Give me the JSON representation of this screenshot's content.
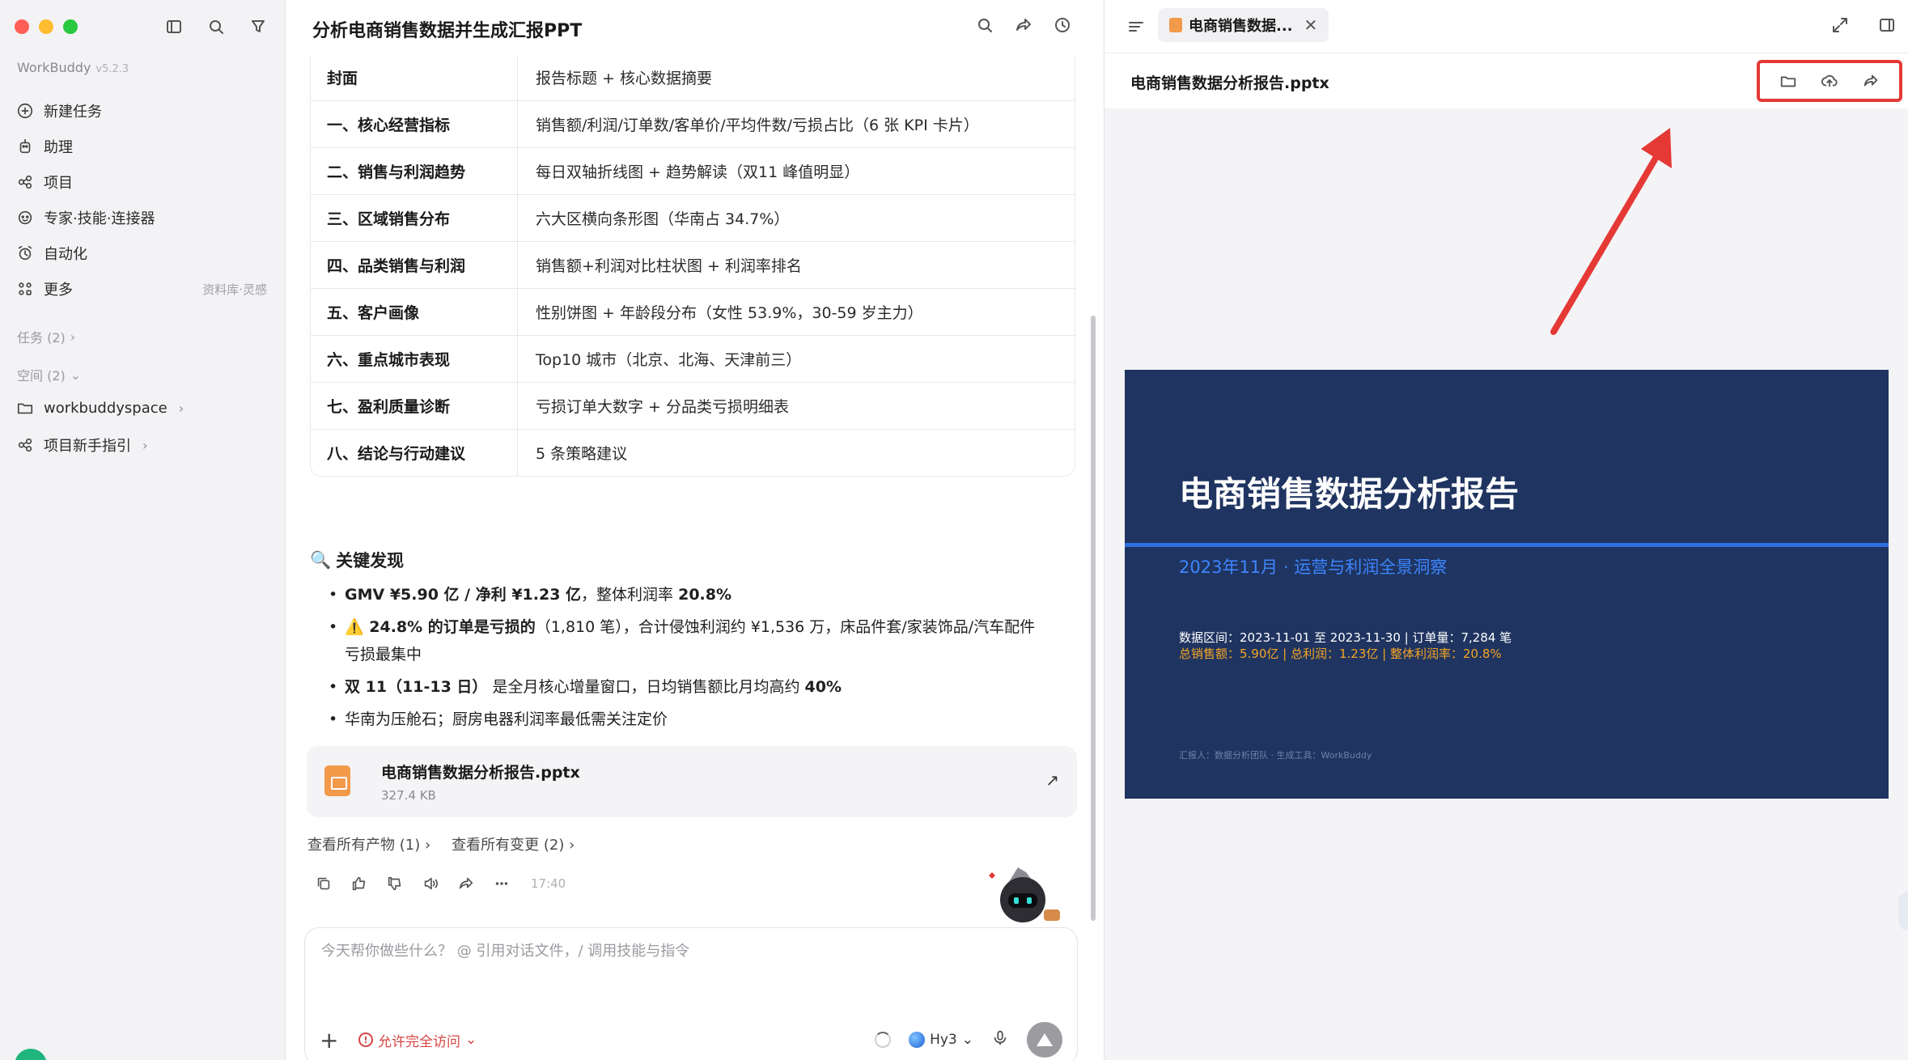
{
  "sidebar": {
    "brand": "WorkBuddy",
    "version": "v5.2.3",
    "nav": [
      {
        "label": "新建任务",
        "icon": "plus-circle-icon"
      },
      {
        "label": "助理",
        "icon": "assistant-icon"
      },
      {
        "label": "项目",
        "icon": "project-icon"
      },
      {
        "label": "专家·技能·连接器",
        "icon": "expert-icon"
      },
      {
        "label": "自动化",
        "icon": "alarm-icon"
      },
      {
        "label": "更多",
        "icon": "grid-icon",
        "right": "资料库·灵感"
      }
    ],
    "tasks_header": "任务 (2)",
    "spaces_header": "空间 (2)",
    "spaces": [
      {
        "label": "workbuddyspace",
        "icon": "folder-icon"
      },
      {
        "label": "项目新手指引",
        "icon": "project-icon"
      }
    ]
  },
  "chat": {
    "title": "分析电商销售数据并生成汇报PPT",
    "table": [
      {
        "section": "封面",
        "content": "报告标题 + 核心数据摘要"
      },
      {
        "section": "一、核心经营指标",
        "content": "销售额/利润/订单数/客单价/平均件数/亏损占比（6 张 KPI 卡片）"
      },
      {
        "section": "二、销售与利润趋势",
        "content": "每日双轴折线图 + 趋势解读（双11 峰值明显）"
      },
      {
        "section": "三、区域销售分布",
        "content": "六大区横向条形图（华南占 34.7%）"
      },
      {
        "section": "四、品类销售与利润",
        "content": "销售额+利润对比柱状图 + 利润率排名"
      },
      {
        "section": "五、客户画像",
        "content": "性别饼图 + 年龄段分布（女性 53.9%，30-59 岁主力）"
      },
      {
        "section": "六、重点城市表现",
        "content": "Top10 城市（北京、北海、天津前三）"
      },
      {
        "section": "七、盈利质量诊断",
        "content": "亏损订单大数字 + 分品类亏损明细表"
      },
      {
        "section": "八、结论与行动建议",
        "content": "5 条策略建议"
      }
    ],
    "key_findings_title": "关键发现",
    "findings": [
      {
        "bold": "GMV ¥5.90 亿 / 净利 ¥1.23 亿",
        "rest": "，整体利润率 ",
        "bold2": "20.8%",
        "rest2": ""
      },
      {
        "bold": "⚠️ 24.8% 的订单是亏损的",
        "rest": "（1,810 笔），合计侵蚀利润约 ¥1,536 万，床品件套/家装饰品/汽车配件亏损最集中",
        "bold2": "",
        "rest2": ""
      },
      {
        "bold": "双 11（11-13 日）",
        "rest": " 是全月核心增量窗口，日均销售额比月均高约 ",
        "bold2": "40%",
        "rest2": ""
      },
      {
        "bold": "",
        "rest": "华南为压舱石；厨房电器利润率最低需关注定价",
        "bold2": "",
        "rest2": ""
      }
    ],
    "file": {
      "name": "电商销售数据分析报告.pptx",
      "size": "327.4 KB"
    },
    "links": [
      "查看所有产物 (1)",
      "查看所有变更 (2)"
    ],
    "time": "17:40",
    "input_placeholder": "今天帮你做些什么？ @ 引用对话文件，/ 调用技能与指令",
    "permission": "允许完全访问",
    "model": "Hy3"
  },
  "preview": {
    "tab_label": "电商销售数据...",
    "filename": "电商销售数据分析报告.pptx",
    "slide": {
      "title": "电商销售数据分析报告",
      "subtitle": "2023年11月 · 运营与利润全景洞察",
      "meta1": "数据区间：2023-11-01 至 2023-11-30   |   订单量：7,284 笔",
      "meta2": "总销售额：5.90亿   |   总利润：1.23亿   |   整体利润率：20.8%",
      "footer": "汇报人：数据分析团队  ·  生成工具：WorkBuddy"
    }
  },
  "colors": {
    "accent_red": "#e53935",
    "slide_bg": "#1f3460",
    "slide_accent": "#2f6fe0",
    "slide_orange": "#f5a524"
  }
}
